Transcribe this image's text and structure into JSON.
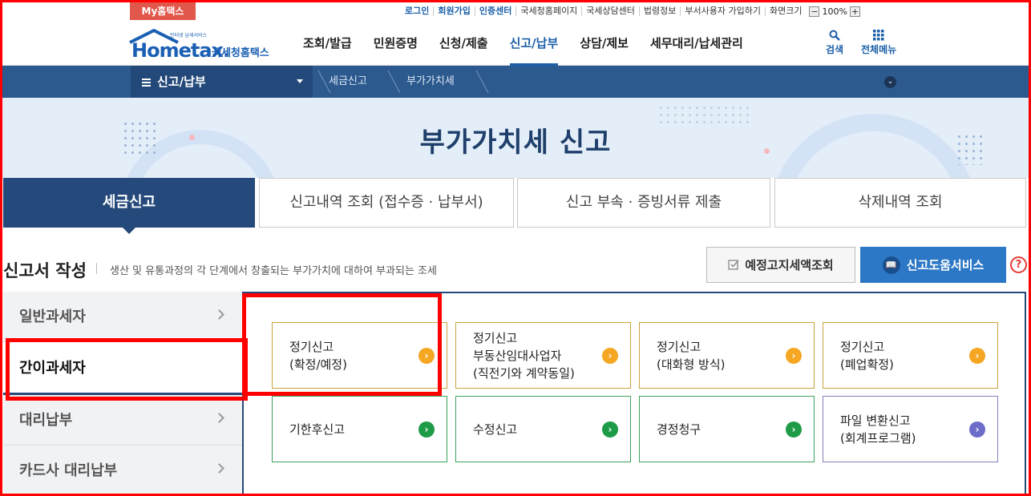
{
  "utility": {
    "my_tab": "My홈택스",
    "links": [
      "로그인",
      "회원가입",
      "인증센터",
      "국세청홈페이지",
      "국세상담센터",
      "법령정보",
      "부서사용자 가입하기",
      "화면크기"
    ],
    "zoom_value": "100%",
    "zoom_minus": "−",
    "zoom_plus": "+"
  },
  "header": {
    "logo_word": "Hometax.",
    "logo_name": "국세청홈택스",
    "logo_tiny": "인터넷 납세서비스",
    "menu": [
      "조회/발급",
      "민원증명",
      "신청/제출",
      "신고/납부",
      "상담/제보",
      "세무대리/납세관리"
    ],
    "search_label": "검색",
    "all_menu_label": "전체메뉴"
  },
  "location": {
    "menu_label": "신고/납부",
    "crumbs": [
      "세금신고",
      "부가가치세"
    ]
  },
  "banner": {
    "title": "부가가치세 신고"
  },
  "tabs": [
    "세금신고",
    "신고내역 조회 (접수증 · 납부서)",
    "신고 부속 · 증빙서류 제출",
    "삭제내역 조회"
  ],
  "section": {
    "title": "신고서 작성",
    "description": "생산 및 유통과정의 각 단계에서 창출되는 부가가치에 대하여 부과되는 조세",
    "notice_button": "예정고지세액조회",
    "help_button": "신고도움서비스",
    "help_q": "?"
  },
  "lnb": [
    "일반과세자",
    "간이과세자",
    "대리납부",
    "카드사 대리납부"
  ],
  "cards": [
    {
      "lines": [
        "정기신고",
        "(확정/예정)"
      ]
    },
    {
      "lines": [
        "정기신고",
        "부동산임대사업자",
        "(직전기와 계약동일)"
      ]
    },
    {
      "lines": [
        "정기신고",
        "(대화형 방식)"
      ]
    },
    {
      "lines": [
        "정기신고",
        "(폐업확정)"
      ]
    },
    {
      "lines": [
        "기한후신고"
      ]
    },
    {
      "lines": [
        "수정신고"
      ]
    },
    {
      "lines": [
        "경정청구"
      ]
    },
    {
      "lines": [
        "파일 변환신고",
        "(회계프로그램)"
      ]
    }
  ],
  "colors": {
    "brand_navy": "#24497a",
    "accent_blue": "#1b5fa8",
    "highlight_red": "#ff0000"
  }
}
